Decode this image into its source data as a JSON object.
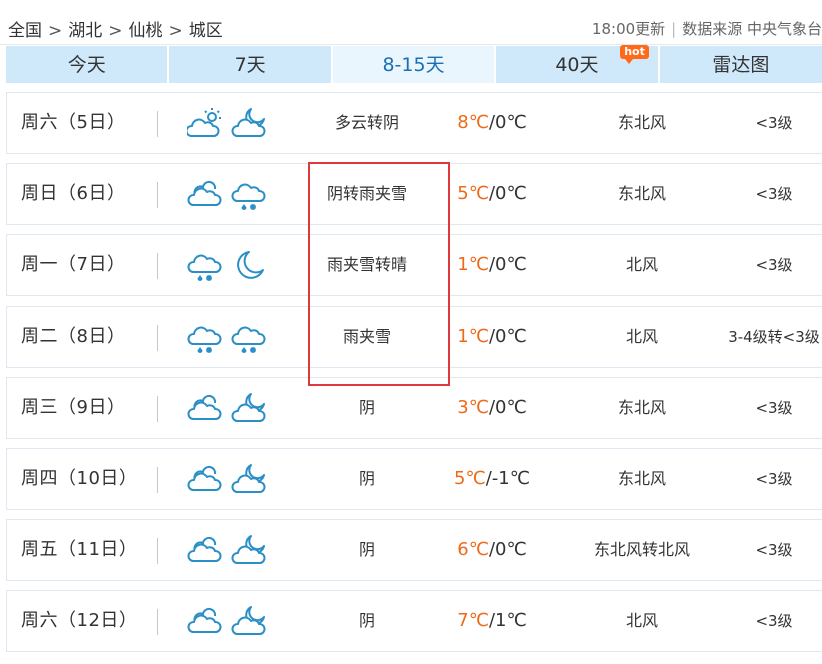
{
  "breadcrumb": [
    "全国",
    "湖北",
    "仙桃",
    "城区"
  ],
  "breadcrumb_separator": ">",
  "update_time": "18:00更新",
  "source_divider": "|",
  "data_source": "数据来源 中央气象台",
  "tabs": [
    {
      "label": "今天",
      "active": false
    },
    {
      "label": "7天",
      "active": false
    },
    {
      "label": "8-15天",
      "active": true
    },
    {
      "label": "40天",
      "active": false,
      "badge": "hot"
    },
    {
      "label": "雷达图",
      "active": false
    }
  ],
  "colors": {
    "tab_bg": "#cfe9fb",
    "tab_active_bg": "#eaf6fe",
    "tab_active_text": "#1a6fb5",
    "temp_high": "#ee6a1a",
    "highlight_border": "#e0383c",
    "icon_stroke": "#2b8fc7"
  },
  "forecast": [
    {
      "day": "周六（5日）",
      "day_icon": "cloudy-sun-icon",
      "night_icon": "cloudy-moon-icon",
      "weather": "多云转阴",
      "high": "8℃",
      "low": "/0℃",
      "wind": "东北风",
      "level": "<3级"
    },
    {
      "day": "周日（6日）",
      "day_icon": "overcast-icon",
      "night_icon": "sleet-icon",
      "weather": "阴转雨夹雪",
      "high": "5℃",
      "low": "/0℃",
      "wind": "东北风",
      "level": "<3级"
    },
    {
      "day": "周一（7日）",
      "day_icon": "sleet-icon",
      "night_icon": "moon-icon",
      "weather": "雨夹雪转晴",
      "high": "1℃",
      "low": "/0℃",
      "wind": "北风",
      "level": "<3级"
    },
    {
      "day": "周二（8日）",
      "day_icon": "sleet-icon",
      "night_icon": "sleet-icon",
      "weather": "雨夹雪",
      "high": "1℃",
      "low": "/0℃",
      "wind": "北风",
      "level": "3-4级转<3级"
    },
    {
      "day": "周三（9日）",
      "day_icon": "overcast-icon",
      "night_icon": "cloudy-moon-icon",
      "weather": "阴",
      "high": "3℃",
      "low": "/0℃",
      "wind": "东北风",
      "level": "<3级"
    },
    {
      "day": "周四（10日）",
      "day_icon": "overcast-icon",
      "night_icon": "cloudy-moon-icon",
      "weather": "阴",
      "high": "5℃",
      "low": "/-1℃",
      "wind": "东北风",
      "level": "<3级"
    },
    {
      "day": "周五（11日）",
      "day_icon": "overcast-icon",
      "night_icon": "cloudy-moon-icon",
      "weather": "阴",
      "high": "6℃",
      "low": "/0℃",
      "wind": "东北风转北风",
      "level": "<3级"
    },
    {
      "day": "周六（12日）",
      "day_icon": "overcast-icon",
      "night_icon": "cloudy-moon-icon",
      "weather": "阴",
      "high": "7℃",
      "low": "/1℃",
      "wind": "北风",
      "level": "<3级"
    }
  ]
}
